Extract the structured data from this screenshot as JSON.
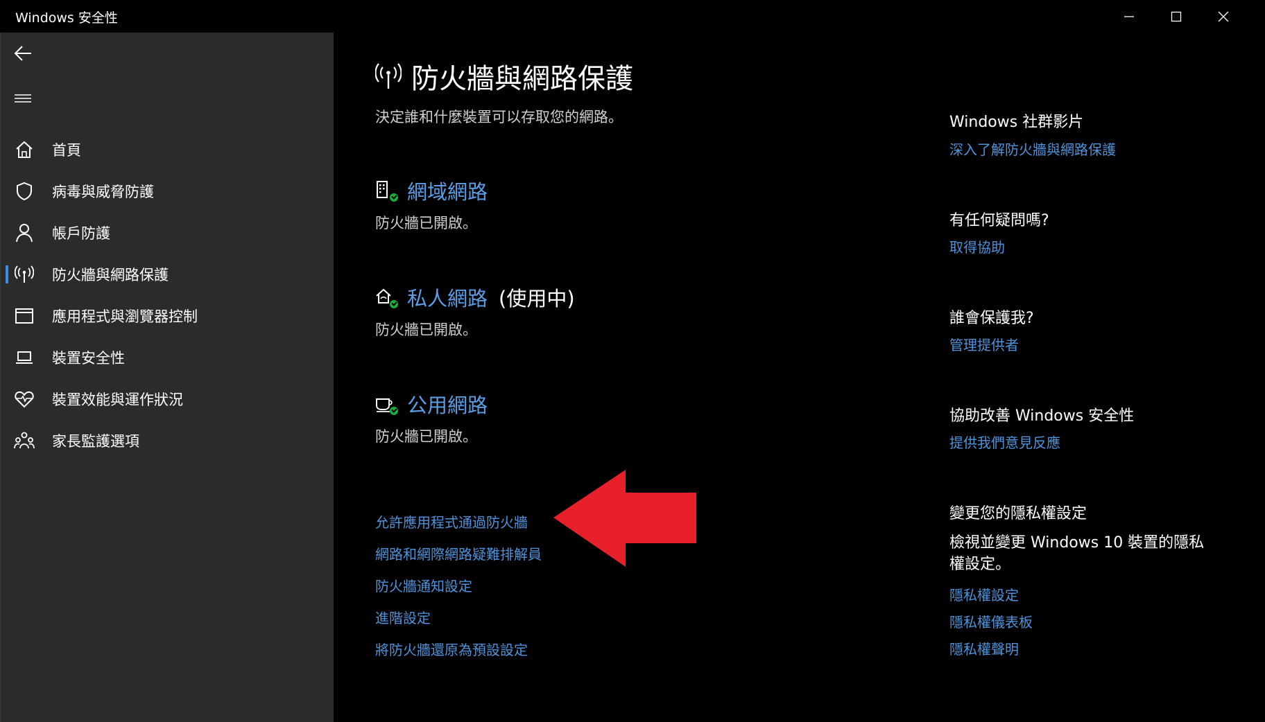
{
  "window": {
    "title": "Windows 安全性"
  },
  "sidebar": {
    "items": [
      {
        "label": "首頁",
        "icon": "home-icon"
      },
      {
        "label": "病毒與威脅防護",
        "icon": "shield-icon"
      },
      {
        "label": "帳戶防護",
        "icon": "person-icon"
      },
      {
        "label": "防火牆與網路保護",
        "icon": "antenna-icon",
        "active": true
      },
      {
        "label": "應用程式與瀏覽器控制",
        "icon": "browser-window-icon"
      },
      {
        "label": "裝置安全性",
        "icon": "laptop-icon"
      },
      {
        "label": "裝置效能與運作狀況",
        "icon": "heart-pulse-icon"
      },
      {
        "label": "家長監護選項",
        "icon": "family-icon"
      }
    ]
  },
  "main": {
    "title": "防火牆與網路保護",
    "subtitle": "決定誰和什麼裝置可以存取您的網路。",
    "networks": [
      {
        "name": "網域網路",
        "active_label": "",
        "status": "防火牆已開啟。"
      },
      {
        "name": "私人網路",
        "active_label": "(使用中)",
        "status": "防火牆已開啟。"
      },
      {
        "name": "公用網路",
        "active_label": "",
        "status": "防火牆已開啟。"
      }
    ],
    "links": [
      "允許應用程式通過防火牆",
      "網路和網際網路疑難排解員",
      "防火牆通知設定",
      "進階設定",
      "將防火牆還原為預設設定"
    ]
  },
  "right": {
    "community": {
      "heading": "Windows 社群影片",
      "link": "深入了解防火牆與網路保護"
    },
    "question": {
      "heading": "有任何疑問嗎?",
      "link": "取得協助"
    },
    "protect": {
      "heading": "誰會保護我?",
      "link": "管理提供者"
    },
    "improve": {
      "heading": "協助改善 Windows 安全性",
      "link": "提供我們意見反應"
    },
    "privacy": {
      "heading": "變更您的隱私權設定",
      "text": "檢視並變更 Windows 10 裝置的隱私權設定。",
      "links": [
        "隱私權設定",
        "隱私權儀表板",
        "隱私權聲明"
      ]
    }
  },
  "colors": {
    "link": "#4f93db",
    "accent": "#3a8eea",
    "check": "#1faa3c",
    "arrow": "#e8202a"
  }
}
